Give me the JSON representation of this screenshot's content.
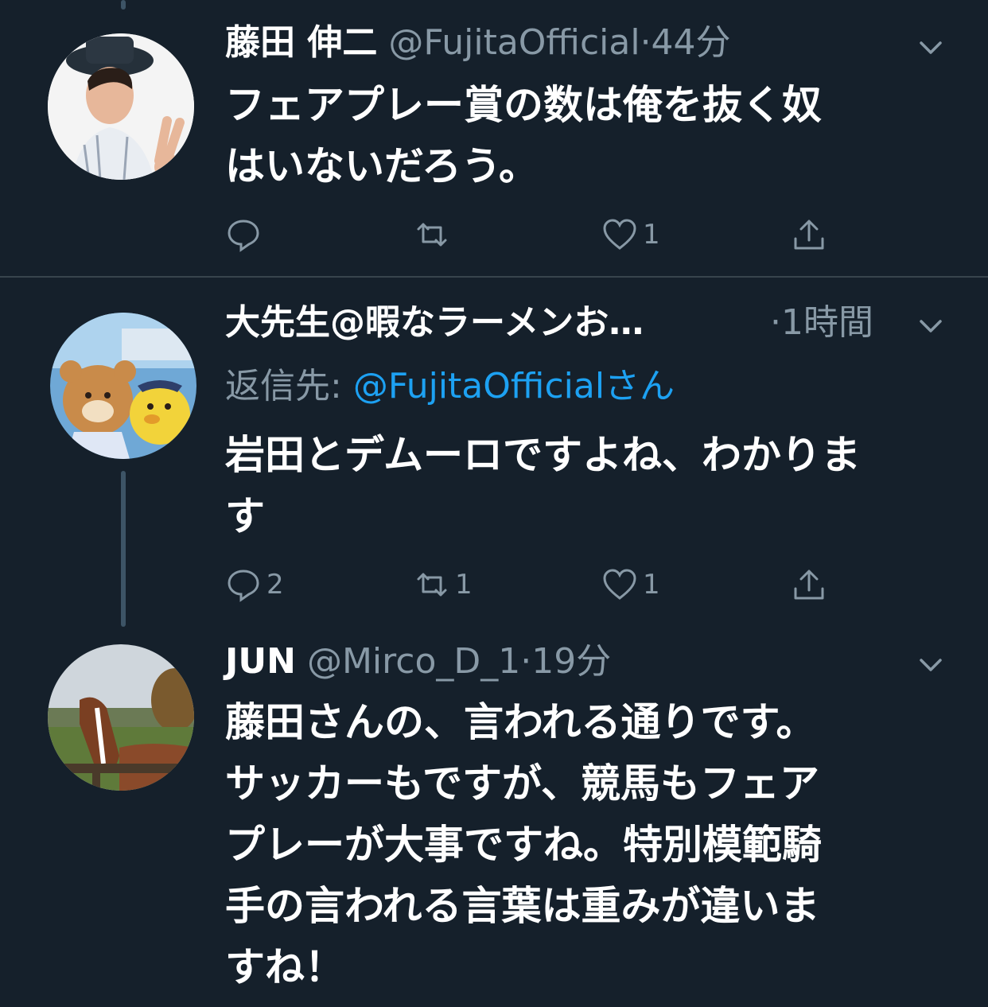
{
  "tweets": [
    {
      "name": "藤田 伸二",
      "handle": "@FujitaOfficial",
      "time": "·44分",
      "body_lines": [
        "フェアプレー賞の数は俺を抜く奴",
        "はいないだろう。"
      ],
      "actions": {
        "reply": "",
        "retweet": "",
        "like": "1"
      }
    },
    {
      "name": "大先生@暇なラーメンお…",
      "handle": "",
      "time": "·1時間",
      "reply_prefix": "返信先: ",
      "reply_mention": "@FujitaOfficialさん",
      "body_lines": [
        "岩田とデムーロですよね、わかりま",
        "す"
      ],
      "actions": {
        "reply": "2",
        "retweet": "1",
        "like": "1"
      }
    },
    {
      "name": "JUN",
      "handle": "@Mirco_D_1",
      "time": "·19分",
      "body_lines": [
        "藤田さんの、言われる通りです。",
        "サッカーもですが、競馬もフェア",
        "プレーが大事ですね。特別模範騎",
        "手の言われる言葉は重みが違いま",
        "すね！"
      ]
    }
  ],
  "icons": {
    "reply": "reply-icon",
    "retweet": "retweet-icon",
    "like": "heart-icon",
    "share": "share-icon",
    "more": "chevron-down-icon"
  },
  "colors": {
    "background": "#15202b",
    "secondary_text": "#8899a6",
    "link": "#1da1f2",
    "divider": "#38444d"
  }
}
